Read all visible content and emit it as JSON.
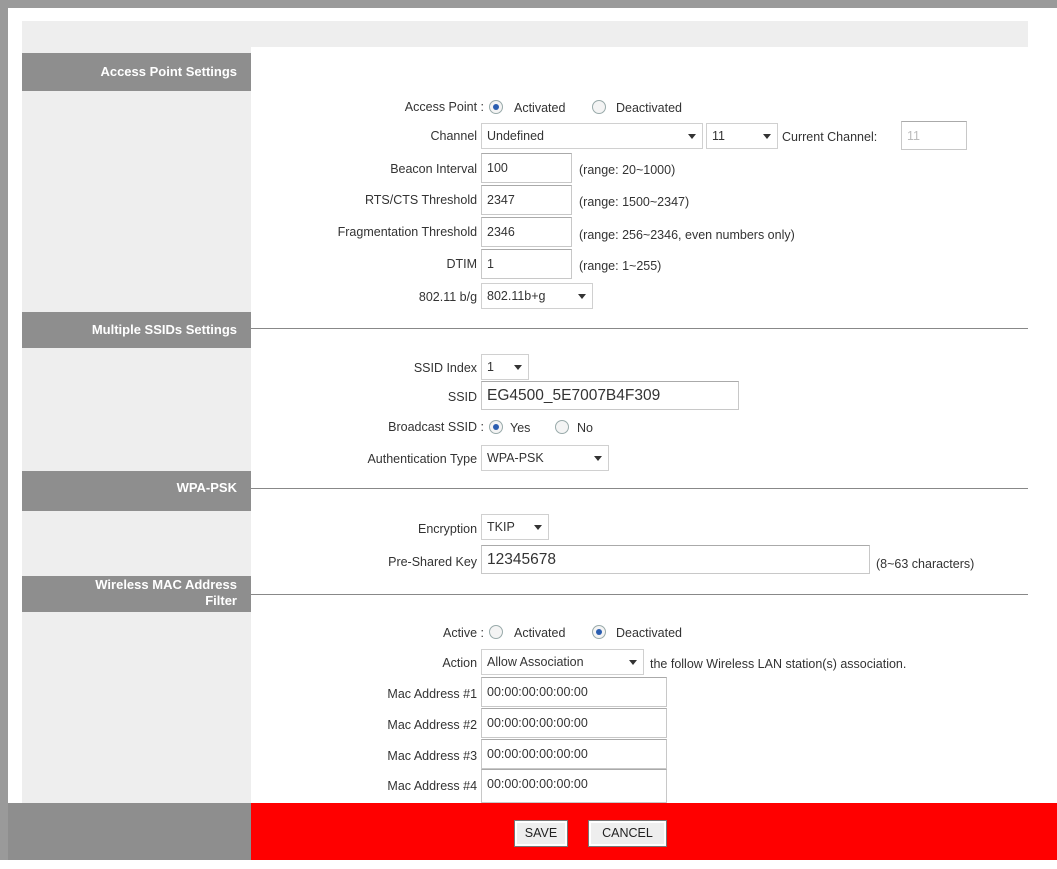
{
  "sections": {
    "access_point": "Access Point Settings",
    "multiple_ssids": "Multiple SSIDs Settings",
    "wpa_psk": "WPA-PSK",
    "mac_filter_line1": "Wireless MAC Address",
    "mac_filter_line2": "Filter"
  },
  "access_point": {
    "label": "Access Point :",
    "options": {
      "activated": "Activated",
      "deactivated": "Deactivated"
    },
    "selected": "Activated"
  },
  "channel": {
    "label": "Channel :",
    "region_value": "Undefined",
    "channel_value": "11",
    "current_label": "Current Channel:",
    "current_value": "11"
  },
  "beacon": {
    "label": "Beacon Interval :",
    "value": "100",
    "range": "(range: 20~1000)"
  },
  "rts": {
    "label": "RTS/CTS Threshold :",
    "value": "2347",
    "range": "(range: 1500~2347)"
  },
  "frag": {
    "label": "Fragmentation Threshold :",
    "value": "2346",
    "range": "(range: 256~2346, even numbers only)"
  },
  "dtim": {
    "label": "DTIM :",
    "value": "1",
    "range": "(range: 1~255)"
  },
  "mode": {
    "label": "802.11 b/g :",
    "value": "802.11b+g"
  },
  "ssid_index": {
    "label": "SSID Index :",
    "value": "1"
  },
  "ssid": {
    "label": "SSID :",
    "value": "EG4500_5E7007B4F309"
  },
  "broadcast": {
    "label": "Broadcast SSID :",
    "yes": "Yes",
    "no": "No",
    "selected": "Yes"
  },
  "auth": {
    "label": "Authentication Type :",
    "value": "WPA-PSK"
  },
  "encryption": {
    "label": "Encryption :",
    "value": "TKIP"
  },
  "psk": {
    "label": "Pre-Shared Key :",
    "value": "12345678",
    "hint": "(8~63 characters)"
  },
  "mac_active": {
    "label": "Active :",
    "options": {
      "activated": "Activated",
      "deactivated": "Deactivated"
    },
    "selected": "Deactivated"
  },
  "mac_action": {
    "label": "Action :",
    "value": "Allow Association",
    "suffix": "the follow Wireless LAN station(s) association."
  },
  "mac_addresses": [
    {
      "label": "Mac Address #1 :",
      "value": "00:00:00:00:00:00"
    },
    {
      "label": "Mac Address #2 :",
      "value": "00:00:00:00:00:00"
    },
    {
      "label": "Mac Address #3 :",
      "value": "00:00:00:00:00:00"
    },
    {
      "label": "Mac Address #4 :",
      "value": "00:00:00:00:00:00"
    }
  ],
  "buttons": {
    "save": "SAVE",
    "cancel": "CANCEL"
  },
  "colors": {
    "header_gray": "#8e8e8e",
    "panel_gray": "#eeeeee",
    "footer_red": "#ff0000",
    "radio_blue": "#2a5db0"
  }
}
